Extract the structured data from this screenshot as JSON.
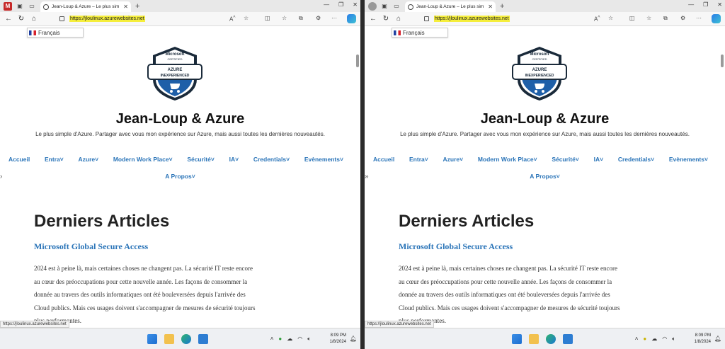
{
  "screens": [
    {
      "tab_title": "Jean-Loup & Azure – Le plus sim",
      "url": "https://jloulinux.azurewebsites.net",
      "status_url": "https://jloulinux.azurewebsites.net",
      "time": "8:09 PM",
      "date": "1/8/2024"
    },
    {
      "tab_title": "Jean-Loup & Azure – Le plus sim",
      "url": "https://jloulinux.azurewebsites.net",
      "status_url": "https://jloulinux.azurewebsites.net",
      "time": "8:09 PM",
      "date": "1/8/2024"
    }
  ],
  "page": {
    "language": "Français",
    "badge": {
      "brand": "Microsoft",
      "certified": "CERTIFIED",
      "line1": "AZURE",
      "line2": "INEXPERIENCED"
    },
    "site_title": "Jean-Loup & Azure",
    "tagline": "Le plus simple d'Azure. Partager avec vous mon expérience sur Azure, mais aussi toutes les dernières nouveautés.",
    "menu": [
      "Accueil",
      "Entra˅",
      "Azure˅",
      "Modern Work Place˅",
      "Sécurité˅",
      "IA˅",
      "Credentials˅",
      "Evènements˅"
    ],
    "menu_second_row": "A Propos˅",
    "section_heading": "Derniers Articles",
    "post_title": "Microsoft Global Secure Access",
    "post_lines": [
      "2024 est à peine là, mais certaines choses ne changent pas. La sécurité IT reste encore",
      "au cœur des préoccupations pour cette nouvelle année. Les façons de consommer la",
      "donnée au travers des outils informatiques ont été bouleversées depuis l'arrivée des",
      "Cloud publics. Mais ces usages doivent s'accompagner de mesures de sécurité toujours",
      "plus performantes."
    ]
  },
  "colors": {
    "link": "#2a74b8",
    "url_highlight": "#f5ee3c",
    "badge_blue": "#1e5fa8",
    "badge_dark": "#1a2a3a"
  },
  "icons": [
    "tab-actions-icon",
    "workspaces-icon",
    "back-icon",
    "refresh-icon",
    "home-icon",
    "lock-icon",
    "read-aloud-icon",
    "favorite-icon",
    "split-screen-icon",
    "favorites-icon",
    "collections-icon",
    "extensions-icon",
    "more-icon",
    "copilot-icon",
    "windows-start-icon",
    "file-explorer-icon",
    "edge-icon",
    "store-icon"
  ]
}
